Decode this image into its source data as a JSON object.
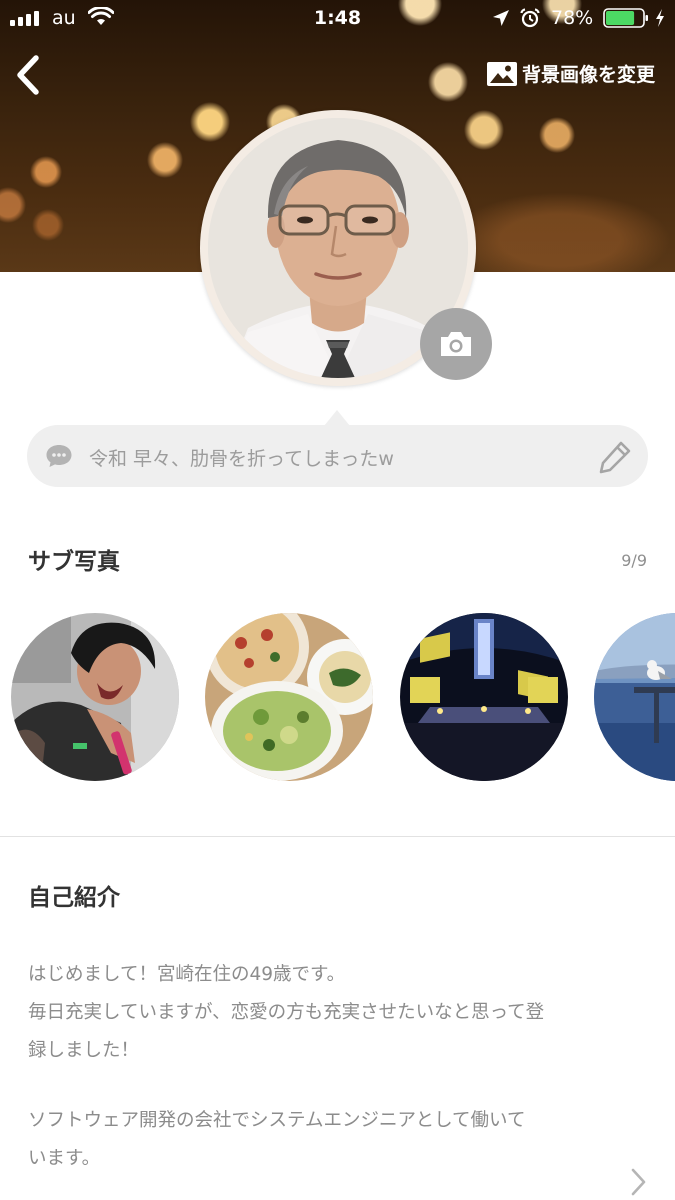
{
  "status_bar": {
    "carrier": "au",
    "time": "1:48",
    "battery_percent": "78%",
    "battery_level": 0.78,
    "icons": [
      "signal-icon",
      "wifi-icon",
      "location-icon",
      "alarm-icon",
      "battery-icon",
      "charging-bolt-icon"
    ]
  },
  "nav": {
    "back_icon": "chevron-left-icon",
    "change_background_label": "背景画像を変更"
  },
  "profile": {
    "status_message": "令和 早々、肋骨を折ってしまったw"
  },
  "sub_photos": {
    "title": "サブ写真",
    "count": "9/9",
    "items": [
      "singer-photo",
      "food-photo",
      "concert-photo",
      "seagull-photo"
    ]
  },
  "intro": {
    "title": "自己紹介",
    "line1": "はじめまして！宮崎在住の49歳です。",
    "line2": "毎日充実していますが、恋愛の方も充実させたいなと思って登",
    "line3": "録しました！",
    "line4": "ソフトウェア開発の会社でシステムエンジニアとして働いて",
    "line5": "います。"
  },
  "colors": {
    "bubble_bg": "#efefef",
    "camera_button": "#a6a6a6",
    "muted_text": "#8c8c8c",
    "battery_green": "#4cd964"
  }
}
